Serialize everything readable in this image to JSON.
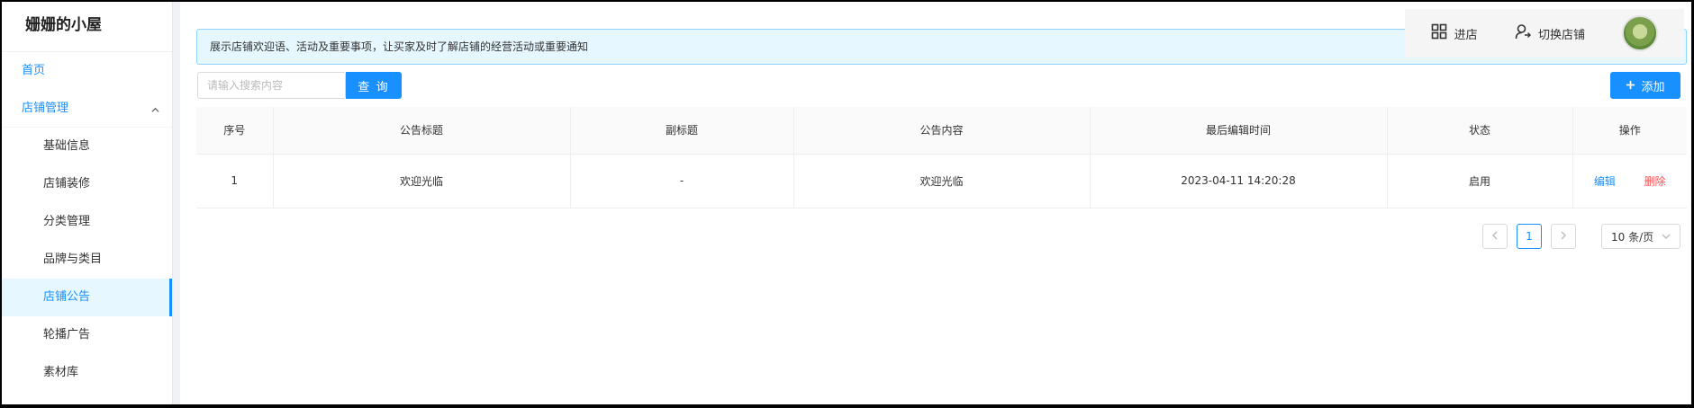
{
  "sidebar": {
    "brand": "姗姗的小屋",
    "home": "首页",
    "group": "店铺管理",
    "items": [
      {
        "label": "基础信息"
      },
      {
        "label": "店铺装修"
      },
      {
        "label": "分类管理"
      },
      {
        "label": "品牌与类目"
      },
      {
        "label": "店铺公告",
        "active": true
      },
      {
        "label": "轮播广告"
      },
      {
        "label": "素材库"
      }
    ]
  },
  "header": {
    "enter_store": "进店",
    "switch_store": "切换店铺",
    "avatar_icon": "store-avatar"
  },
  "notice": "展示店铺欢迎语、活动及重要事项，让买家及时了解店铺的经营活动或重要通知",
  "toolbar": {
    "search_placeholder": "请输入搜索内容",
    "search_label": "查 询",
    "add_label": "添加"
  },
  "table": {
    "columns": [
      "序号",
      "公告标题",
      "副标题",
      "公告内容",
      "最后编辑时间",
      "状态",
      "操作"
    ],
    "rows": [
      {
        "index": "1",
        "title": "欢迎光临",
        "subtitle": "-",
        "content": "欢迎光临",
        "edited_at": "2023-04-11 14:20:28",
        "status": "启用",
        "edit": "编辑",
        "delete": "删除"
      }
    ]
  },
  "pagination": {
    "current_page": "1",
    "page_size": "10 条/页"
  },
  "colors": {
    "accent": "#1890ff",
    "success": "#52c41a",
    "danger": "#ff4d4f",
    "notice_bg": "#e6f7ff"
  }
}
